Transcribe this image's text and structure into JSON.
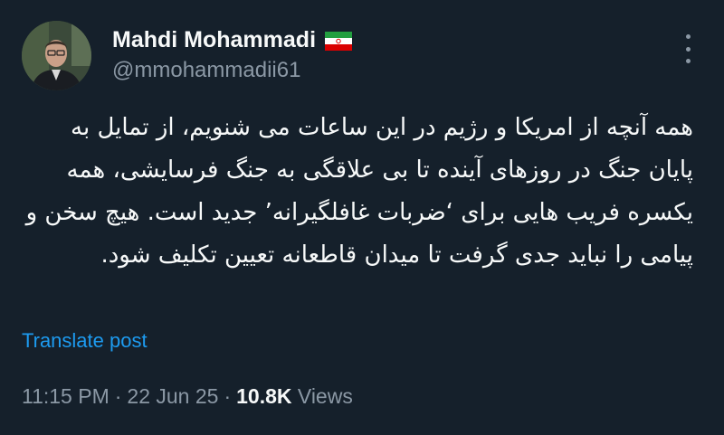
{
  "author": {
    "display_name": "Mahdi Mohammadi",
    "handle": "@mmohammadii61",
    "flag_icon": "iran-flag-icon"
  },
  "tweet": {
    "text": "همه آنچه از امریکا و رژیم در این ساعات می شنویم، از تمایل به پایان جنگ در روزهای آینده تا بی علاقگی به جنگ فرسایشی، همه یکسره فریب هایی برای ‘ضربات غافلگیرانه’ جدید است. هیچ سخن و پیامی را نباید جدی گرفت تا میدان قاطعانه تعیین تکلیف شود.",
    "translate_label": "Translate post"
  },
  "meta": {
    "time": "11:15 PM",
    "separator": "·",
    "date": "22 Jun 25",
    "views_count": "10.8K",
    "views_label": "Views"
  },
  "colors": {
    "background": "#15202b",
    "text_primary": "#f7f9f9",
    "text_secondary": "#8b98a5",
    "link": "#1d9bf0"
  }
}
